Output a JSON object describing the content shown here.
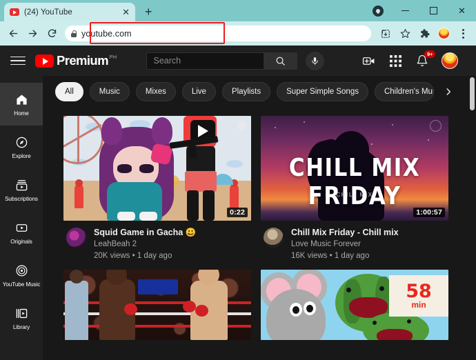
{
  "browser": {
    "tab": {
      "title": "(24) YouTube",
      "favicon": "youtube-favicon",
      "close": "✕"
    },
    "new_tab": "+",
    "window_controls": {
      "minimize": "minimize",
      "maximize": "maximize",
      "close": "✕"
    },
    "nav": {
      "back": "back-arrow",
      "forward": "forward-arrow",
      "reload": "reload-arrow"
    },
    "address": {
      "value": "youtube.com",
      "lock": "secure-lock-icon"
    },
    "toolbar_icons": [
      "install-icon",
      "bookmark-star-icon",
      "extensions-puzzle-icon",
      "extension-avatar-icon",
      "chrome-menu-icon"
    ],
    "annotation_color": "#ee1c1c",
    "theme_color": "#7fc8c8"
  },
  "youtube": {
    "header": {
      "menu": "hamburger-menu",
      "logo_text": "Premium",
      "logo_sup": "PH",
      "search_placeholder": "Search",
      "search_button": "search-icon",
      "mic_button": "microphone-icon",
      "create": "create-video-icon",
      "apps": "youtube-apps-icon",
      "notifications": "notifications-bell-icon",
      "notification_count": "9+",
      "avatar": "account-avatar"
    },
    "sidebar": {
      "items": [
        {
          "label": "Home",
          "icon": "home-icon",
          "active": true
        },
        {
          "label": "Explore",
          "icon": "compass-icon",
          "active": false
        },
        {
          "label": "Subscriptions",
          "icon": "subscriptions-icon",
          "active": false
        },
        {
          "label": "Originals",
          "icon": "originals-icon",
          "active": false
        },
        {
          "label": "YouTube Music",
          "icon": "youtube-music-icon",
          "active": false
        },
        {
          "label": "Library",
          "icon": "library-icon",
          "active": false
        }
      ]
    },
    "chips": [
      {
        "label": "All",
        "active": true
      },
      {
        "label": "Music",
        "active": false
      },
      {
        "label": "Mixes",
        "active": false
      },
      {
        "label": "Live",
        "active": false
      },
      {
        "label": "Playlists",
        "active": false
      },
      {
        "label": "Super Simple Songs",
        "active": false
      },
      {
        "label": "Children's Music",
        "active": false
      }
    ],
    "chips_next": "chevron-right-icon",
    "videos": [
      {
        "title": "Squid Game in Gacha 😃",
        "channel": "LeahBeah 2",
        "stats": "20K views • 1 day ago",
        "duration": "0:22",
        "thumb": "gacha"
      },
      {
        "title": "Chill Mix Friday - Chill mix",
        "channel": "Love Music Forever",
        "stats": "16K views • 1 day ago",
        "duration": "1:00:57",
        "thumb": "chill",
        "thumb_title": "CHILL MIX FRIDAY",
        "thumb_subtitle": "CHILL MIX"
      },
      {
        "thumb": "boxing"
      },
      {
        "thumb": "cartoon",
        "badge_number": "58",
        "badge_unit": "min"
      }
    ]
  }
}
